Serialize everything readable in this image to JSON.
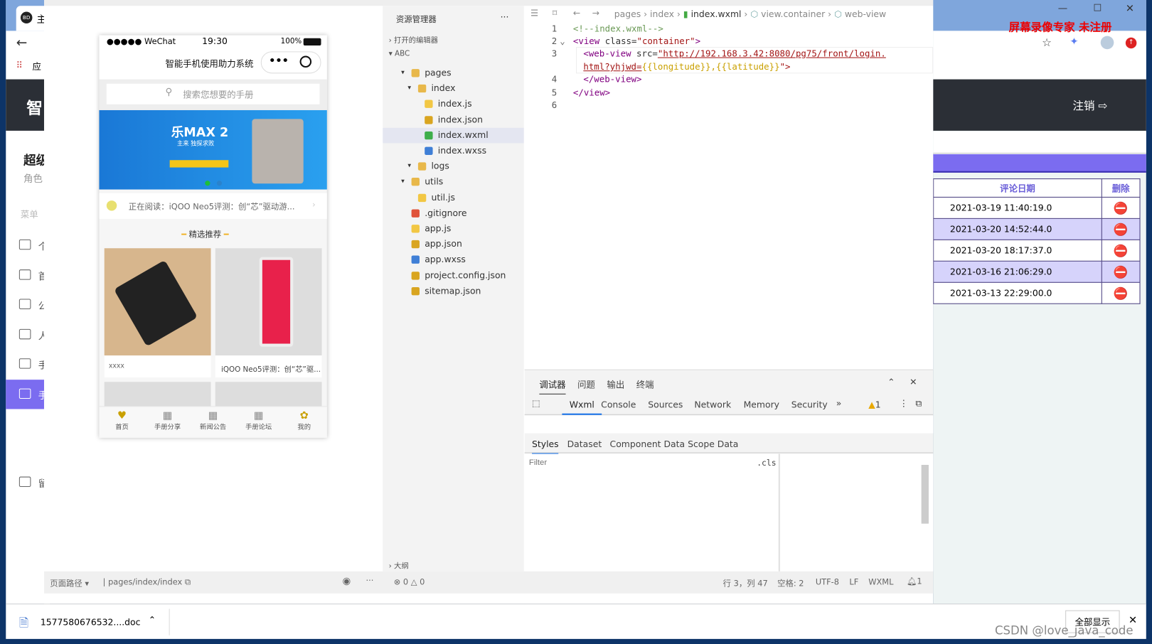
{
  "left_browser": {
    "tab_label": "主",
    "bookmark_label": "应",
    "header_char": "智",
    "user_title": "超级",
    "role_label": "角色",
    "menu_label": "菜单",
    "menu_items": [
      "个",
      "首",
      "公",
      "人",
      "手",
      "手",
      "留"
    ]
  },
  "right_browser": {
    "logout_label": "注销",
    "table": {
      "headers": [
        "评论日期",
        "删除"
      ],
      "rows": [
        "2021-03-19 11:40:19.0",
        "2021-03-20 14:52:44.0",
        "2021-03-20 18:17:37.0",
        "2021-03-16 21:06:29.0",
        "2021-03-13 22:29:00.0"
      ]
    },
    "accent": "#7b6cf0",
    "row_alt": "#d6d3fb",
    "delete_color": "#e04a3a"
  },
  "watermark": "屏幕录像专家 未注册",
  "csdn_watermark": "CSDN @love_java_code",
  "phone": {
    "carrier": "●●●●● WeChat",
    "time": "19:30",
    "battery": "100%",
    "title": "智能手机使用助力系统",
    "search_placeholder": "搜索您想要的手册",
    "banner_title": "乐MAX 2",
    "banner_sub": "主来 独探求败",
    "reading": "正在阅读：iQOO Neo5评测：创“芯”驱动游...",
    "section": "精选推荐",
    "cards": [
      "xxxx",
      "iQOO Neo5评测：创“芯”驱..."
    ],
    "tabs": [
      "首页",
      "手册分享",
      "新闻公告",
      "手册论坛",
      "我的"
    ]
  },
  "explorer": {
    "title": "资源管理器",
    "more": "···",
    "open_editors": "打开的编辑器",
    "project": "ABC",
    "outline": "大纲",
    "tree": [
      {
        "name": "pages",
        "type": "folder",
        "depth": 1
      },
      {
        "name": "index",
        "type": "folder",
        "depth": 2
      },
      {
        "name": "index.js",
        "type": "js",
        "depth": 3
      },
      {
        "name": "index.json",
        "type": "json",
        "depth": 3
      },
      {
        "name": "index.wxml",
        "type": "wxml",
        "depth": 3,
        "selected": true
      },
      {
        "name": "index.wxss",
        "type": "wxss",
        "depth": 3
      },
      {
        "name": "logs",
        "type": "folder",
        "depth": 2
      },
      {
        "name": "utils",
        "type": "folder",
        "depth": 1
      },
      {
        "name": "util.js",
        "type": "js",
        "depth": 2
      },
      {
        "name": ".gitignore",
        "type": "git",
        "depth": 1
      },
      {
        "name": "app.js",
        "type": "js",
        "depth": 1
      },
      {
        "name": "app.json",
        "type": "json",
        "depth": 1
      },
      {
        "name": "app.wxss",
        "type": "wxss",
        "depth": 1
      },
      {
        "name": "project.config.json",
        "type": "json",
        "depth": 1
      },
      {
        "name": "sitemap.json",
        "type": "json",
        "depth": 1
      }
    ]
  },
  "editor": {
    "breadcrumb": [
      "pages",
      "index",
      "index.wxml",
      "view.container",
      "web-view"
    ],
    "lines": {
      "l1": "<!--index.wxml-->",
      "l2a": "<view ",
      "l2b": "class=",
      "l2c": "\"container\"",
      "l2d": ">",
      "l3a": "<web-view ",
      "l3b": "src=",
      "l3c": "\"http://192.168.3.42:8080/pg75/front/login.",
      "l3d": "html?yhjwd=",
      "l3e": "{{longitude}},{{latitude}}",
      "l3f": "\">",
      "l4": "</web-view>",
      "l5": "</view>"
    },
    "line_numbers": [
      "1",
      "2",
      "3",
      "4",
      "5",
      "6"
    ]
  },
  "devtools": {
    "panel_tabs": [
      "调试器",
      "问题",
      "输出",
      "终端"
    ],
    "tabs": [
      "Wxml",
      "Console",
      "Sources",
      "Network",
      "Memory",
      "Security"
    ],
    "more": "»",
    "warnings": "1",
    "sub_tabs": [
      "Styles",
      "Dataset",
      "Component Data",
      "Scope Data"
    ],
    "filter_placeholder": "Filter",
    "cls": ".cls"
  },
  "statusbar": {
    "page_path_label": "页面路径 ▾",
    "page_path": "pages/index/index",
    "errors": "0",
    "warns": "0",
    "position": "行 3，列 47",
    "spaces": "空格: 2",
    "encoding": "UTF-8",
    "eol": "LF",
    "language": "WXML",
    "notifications": "1"
  },
  "download": {
    "file": "1577580676532....doc",
    "show_all": "全部显示"
  }
}
